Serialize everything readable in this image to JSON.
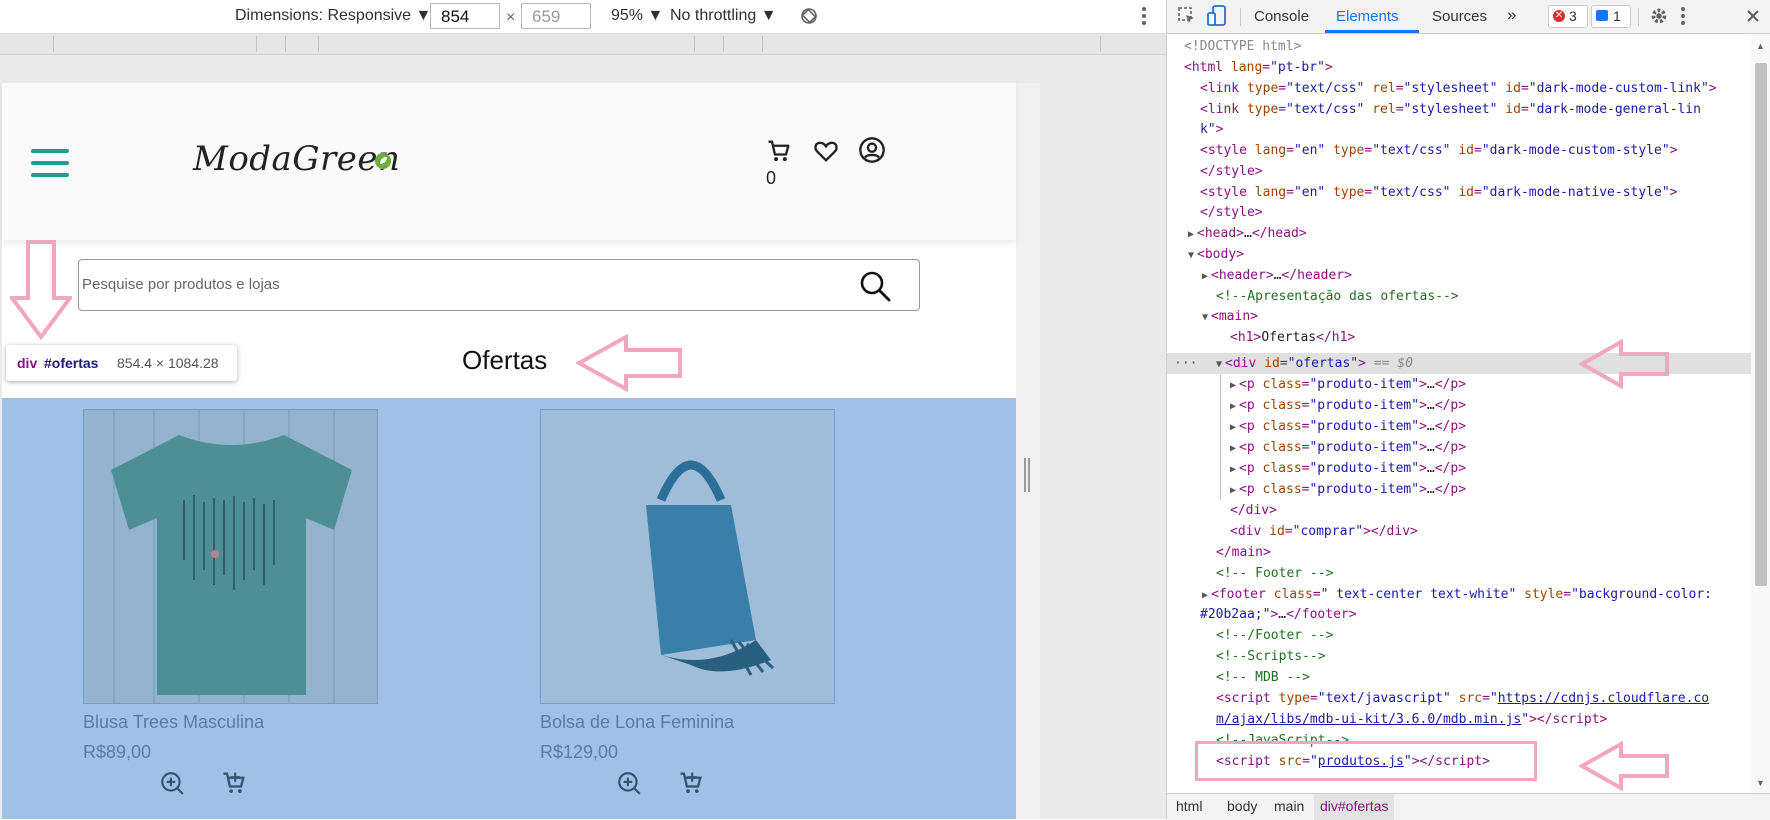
{
  "device_toolbar": {
    "dimensions_label": "Dimensions: Responsive ▼",
    "width_value": "854",
    "times": "×",
    "height_placeholder": "659",
    "zoom": "95% ▼",
    "throttling": "No throttling ▼"
  },
  "page": {
    "logo": "ModaGreen",
    "cart_count": "0",
    "search_placeholder": "Pesquise por produtos e lojas",
    "offers_title": "Ofertas",
    "products": [
      {
        "name": "Blusa Trees Masculina",
        "price": "R$89,00"
      },
      {
        "name": "Bolsa de Lona Feminina",
        "price": "R$129,00"
      }
    ]
  },
  "tooltip": {
    "element": "div",
    "id": "#ofertas",
    "size": "854.4 × 1084.28"
  },
  "devtools": {
    "tabs": [
      "Console",
      "Elements",
      "Sources",
      "»"
    ],
    "active_tab": "Elements",
    "errors": "3",
    "messages": "1",
    "crumbs": [
      "html",
      "body",
      "main",
      "div#ofertas"
    ]
  },
  "colors": {
    "accent": "#1f9c96",
    "highlight": "#9fc1e7",
    "annotation_arrow": "#f2a7c0",
    "footer_bg": "#20b2aa"
  }
}
